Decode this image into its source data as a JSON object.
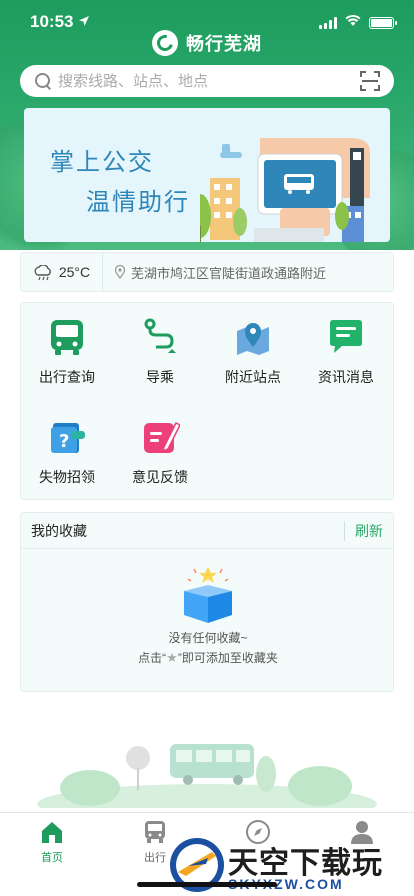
{
  "status_bar": {
    "time": "10:53"
  },
  "header": {
    "app_title": "畅行芜湖"
  },
  "search": {
    "placeholder": "搜索线路、站点、地点"
  },
  "banner": {
    "line1": "掌上公交",
    "line2": "温情助行"
  },
  "weather": {
    "temperature": "25°C",
    "address": "芜湖市鸠江区官陡街道政通路附近"
  },
  "grid": {
    "items": [
      {
        "label": "出行查询",
        "icon": "bus-icon"
      },
      {
        "label": "导乘",
        "icon": "route-icon"
      },
      {
        "label": "附近站点",
        "icon": "map-pin-icon"
      },
      {
        "label": "资讯消息",
        "icon": "message-icon"
      },
      {
        "label": "失物招领",
        "icon": "lost-found-icon"
      },
      {
        "label": "意见反馈",
        "icon": "feedback-icon"
      }
    ]
  },
  "favorites": {
    "title": "我的收藏",
    "refresh": "刷新",
    "empty_line1": "没有任何收藏~",
    "empty_line2_prefix": "点击“",
    "empty_line2_suffix": "”即可添加至收藏夹"
  },
  "tabbar": {
    "items": [
      {
        "label": "首页",
        "icon": "home-icon",
        "active": true
      },
      {
        "label": "出行",
        "icon": "bus-icon",
        "active": false
      },
      {
        "label": "",
        "icon": "compass-icon",
        "active": false
      },
      {
        "label": "",
        "icon": "user-icon",
        "active": false
      }
    ]
  },
  "watermark": {
    "title": "天空下载玩",
    "subtitle": "SKYXZW.COM"
  },
  "colors": {
    "brand_green": "#1e9c5e",
    "accent_blue": "#2f86b8",
    "card_bg": "#f3fcfa"
  }
}
